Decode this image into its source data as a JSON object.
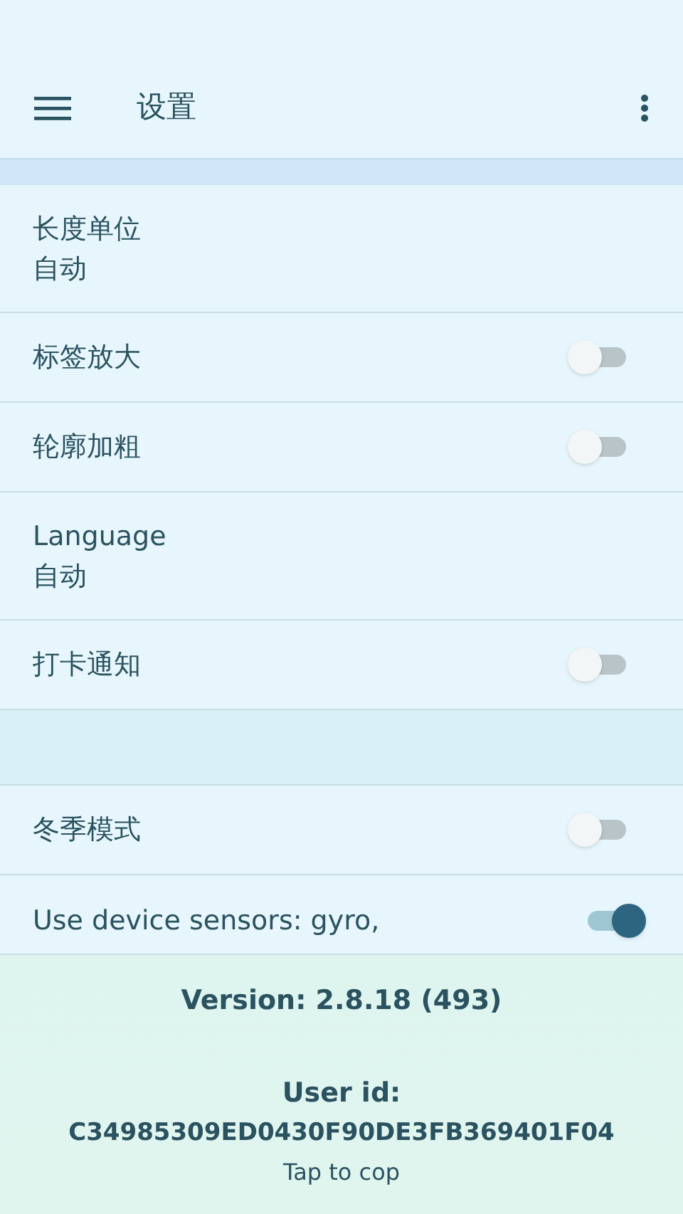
{
  "toolbar": {
    "title": "设置"
  },
  "sections": [
    {
      "items": [
        {
          "kind": "value",
          "title": "长度单位",
          "value": "自动"
        },
        {
          "kind": "switch",
          "title": "标签放大",
          "on": false
        },
        {
          "kind": "switch",
          "title": "轮廓加粗",
          "on": false
        },
        {
          "kind": "value",
          "title": "Language",
          "value": "自动"
        },
        {
          "kind": "switch",
          "title": "打卡通知",
          "on": false
        }
      ]
    },
    {
      "items": [
        {
          "kind": "switch",
          "title": "冬季模式",
          "on": false
        },
        {
          "kind": "switch",
          "title": "Use device sensors: gyro,",
          "on": true
        }
      ]
    }
  ],
  "footer": {
    "version": "Version: 2.8.18 (493)",
    "user_id_label": "User id:",
    "user_id": "C34985309ED0430F90DE3FB369401F04",
    "hint": "Tap to cop"
  }
}
